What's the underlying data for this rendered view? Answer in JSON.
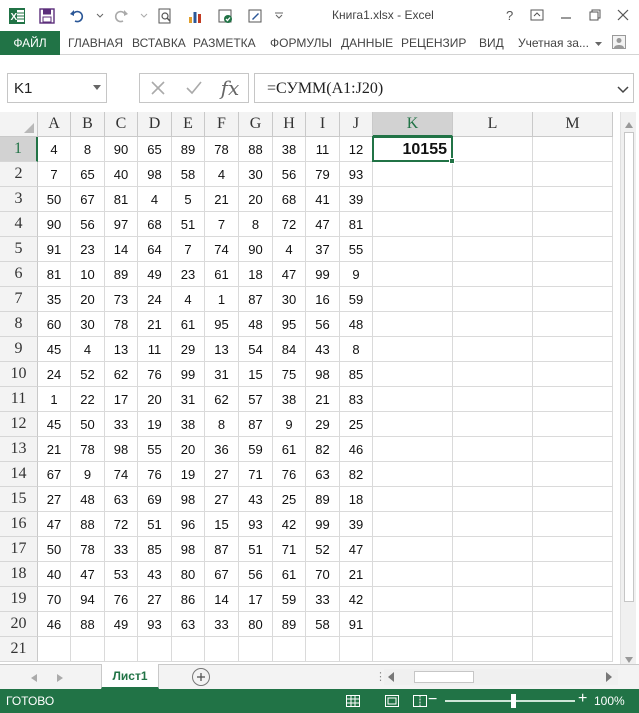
{
  "window": {
    "title": "Книга1.xlsx - Excel"
  },
  "ribbon": {
    "file_tab": "ФАЙЛ",
    "tabs": [
      "ГЛАВНАЯ",
      "ВСТАВКА",
      "РАЗМЕТКА",
      "ФОРМУЛЫ",
      "ДАННЫЕ",
      "РЕЦЕНЗИР",
      "ВИД"
    ],
    "account": "Учетная за..."
  },
  "formula_bar": {
    "name_box": "K1",
    "formula": "=СУММ(A1:J20)",
    "fx_label": "fx"
  },
  "grid": {
    "columns": [
      "A",
      "B",
      "C",
      "D",
      "E",
      "F",
      "G",
      "H",
      "I",
      "J",
      "K",
      "L",
      "M"
    ],
    "selected_column": "K",
    "selected_row": "1",
    "rows": [
      [
        "4",
        "8",
        "90",
        "65",
        "89",
        "78",
        "88",
        "38",
        "11",
        "12"
      ],
      [
        "7",
        "65",
        "40",
        "98",
        "58",
        "4",
        "30",
        "56",
        "79",
        "93"
      ],
      [
        "50",
        "67",
        "81",
        "4",
        "5",
        "21",
        "20",
        "68",
        "41",
        "39"
      ],
      [
        "90",
        "56",
        "97",
        "68",
        "51",
        "7",
        "8",
        "72",
        "47",
        "81"
      ],
      [
        "91",
        "23",
        "14",
        "64",
        "7",
        "74",
        "90",
        "4",
        "37",
        "55"
      ],
      [
        "81",
        "10",
        "89",
        "49",
        "23",
        "61",
        "18",
        "47",
        "99",
        "9"
      ],
      [
        "35",
        "20",
        "73",
        "24",
        "4",
        "1",
        "87",
        "30",
        "16",
        "59"
      ],
      [
        "60",
        "30",
        "78",
        "21",
        "61",
        "95",
        "48",
        "95",
        "56",
        "48"
      ],
      [
        "45",
        "4",
        "13",
        "11",
        "29",
        "13",
        "54",
        "84",
        "43",
        "8"
      ],
      [
        "24",
        "52",
        "62",
        "76",
        "99",
        "31",
        "15",
        "75",
        "98",
        "85"
      ],
      [
        "1",
        "22",
        "17",
        "20",
        "31",
        "62",
        "57",
        "38",
        "21",
        "83"
      ],
      [
        "45",
        "50",
        "33",
        "19",
        "38",
        "8",
        "87",
        "9",
        "29",
        "25"
      ],
      [
        "21",
        "78",
        "98",
        "55",
        "20",
        "36",
        "59",
        "61",
        "82",
        "46"
      ],
      [
        "67",
        "9",
        "74",
        "76",
        "19",
        "27",
        "71",
        "76",
        "63",
        "82"
      ],
      [
        "27",
        "48",
        "63",
        "69",
        "98",
        "27",
        "43",
        "25",
        "89",
        "18"
      ],
      [
        "47",
        "88",
        "72",
        "51",
        "96",
        "15",
        "93",
        "42",
        "99",
        "39"
      ],
      [
        "50",
        "78",
        "33",
        "85",
        "98",
        "87",
        "51",
        "71",
        "52",
        "47"
      ],
      [
        "40",
        "47",
        "53",
        "43",
        "80",
        "67",
        "56",
        "61",
        "70",
        "21"
      ],
      [
        "70",
        "94",
        "76",
        "27",
        "86",
        "14",
        "17",
        "59",
        "33",
        "42"
      ],
      [
        "46",
        "88",
        "49",
        "93",
        "63",
        "33",
        "80",
        "89",
        "58",
        "91"
      ]
    ],
    "row_numbers": [
      "1",
      "2",
      "3",
      "4",
      "5",
      "6",
      "7",
      "8",
      "9",
      "10",
      "11",
      "12",
      "13",
      "14",
      "15",
      "16",
      "17",
      "18",
      "19",
      "20",
      "21"
    ],
    "k1_value": "10155"
  },
  "sheets": {
    "active": "Лист1"
  },
  "status": {
    "ready": "ГОТОВО",
    "zoom": "100%",
    "zoom_level": 100
  },
  "colors": {
    "accent": "#217346"
  }
}
